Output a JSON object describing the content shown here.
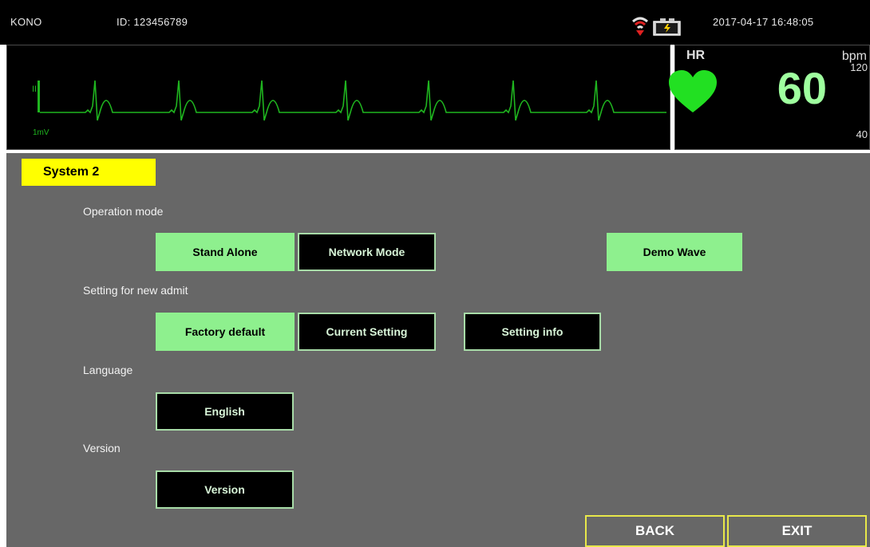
{
  "status_bar": {
    "device": "KONO",
    "patient_id": "ID: 123456789",
    "datetime": "2017-04-17  16:48:05",
    "icons": [
      "wireless-icon",
      "battery-icon"
    ]
  },
  "ecg": {
    "lead": "II",
    "scale": "1mV",
    "color": "#1fb51f"
  },
  "hr": {
    "label": "HR",
    "unit": "bpm",
    "value": "60",
    "upper_limit": "120",
    "lower_limit": "40",
    "color": "#22e022",
    "icon": "heart-icon"
  },
  "page": {
    "title": "System 2"
  },
  "sections": {
    "operation": {
      "label": "Operation mode",
      "stand_alone": "Stand Alone",
      "network_mode": "Network Mode",
      "demo_wave": "Demo Wave"
    },
    "admit": {
      "label": "Setting for new admit",
      "factory_default": "Factory default",
      "current_setting": "Current Setting",
      "setting_info": "Setting info"
    },
    "language": {
      "label": "Language",
      "value": "English"
    },
    "version": {
      "label": "Version",
      "button": "Version"
    }
  },
  "footer": {
    "back": "BACK",
    "exit": "EXIT"
  },
  "colors": {
    "active_button": "#8ef08e",
    "inactive_button": "#000000",
    "title_tab": "#ffff00",
    "panel_gray": "#676767"
  }
}
